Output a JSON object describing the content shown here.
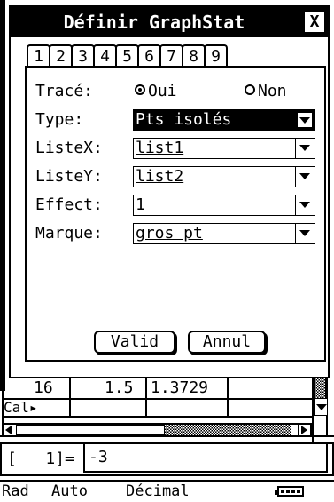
{
  "dialog": {
    "title": "Définir GraphStat",
    "close_label": "X",
    "tabs": [
      "1",
      "2",
      "3",
      "4",
      "5",
      "6",
      "7",
      "8",
      "9"
    ],
    "fields": {
      "trace": {
        "label": "Tracé:",
        "options": [
          "Oui",
          "Non"
        ],
        "selected": "Oui"
      },
      "type": {
        "label": "Type:",
        "value": "Pts isolés"
      },
      "listex": {
        "label": "ListeX:",
        "value": "list1"
      },
      "listey": {
        "label": "ListeY:",
        "value": "list2"
      },
      "effect": {
        "label": "Effect:",
        "value": "1"
      },
      "marque": {
        "label": "Marque:",
        "value": "gros pt"
      }
    },
    "buttons": {
      "ok": "Valid",
      "cancel": "Annul"
    }
  },
  "sheet": {
    "row": {
      "index": "16",
      "col1": "1.5",
      "col2": "1.3729"
    },
    "calc_label": "Cal▸",
    "entry": {
      "cell": "[   1]=",
      "value": "-3"
    }
  },
  "status": {
    "angle": "Rad",
    "mode": "Auto",
    "format": "Décimal",
    "battery_icon": "battery-icon"
  }
}
